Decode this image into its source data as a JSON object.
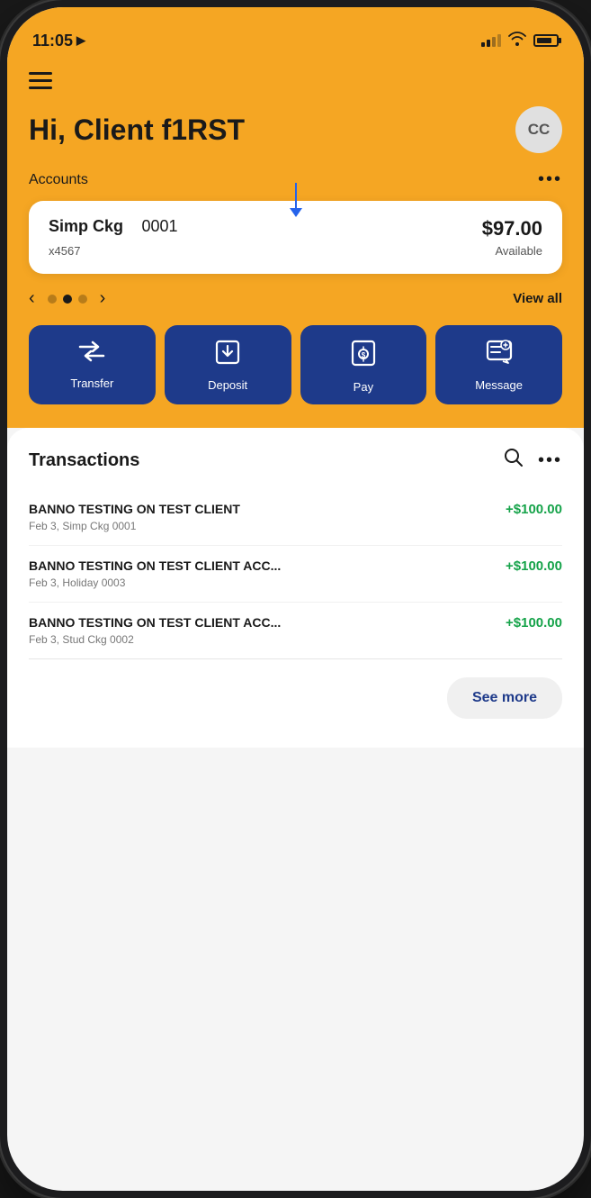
{
  "status_bar": {
    "time": "11:05",
    "location_icon": "▶",
    "battery_label": "battery"
  },
  "header": {
    "menu_label": "≡",
    "greeting": "Hi, Client f1RST",
    "avatar_initials": "CC",
    "accounts_label": "Accounts",
    "more_label": "•••",
    "view_all_label": "View all"
  },
  "account_card": {
    "name": "Simp Ckg",
    "number": "0001",
    "account_sub": "x4567",
    "amount": "$97.00",
    "available_label": "Available"
  },
  "carousel": {
    "prev": "‹",
    "next": "›"
  },
  "action_buttons": [
    {
      "id": "transfer",
      "label": "Transfer"
    },
    {
      "id": "deposit",
      "label": "Deposit"
    },
    {
      "id": "pay",
      "label": "Pay"
    },
    {
      "id": "message",
      "label": "Message"
    }
  ],
  "transactions": {
    "title": "Transactions",
    "items": [
      {
        "name": "BANNO TESTING ON TEST CLIENT",
        "sub": "Feb 3, Simp Ckg     0001",
        "amount": "+$100.00"
      },
      {
        "name": "BANNO TESTING ON TEST CLIENT ACC...",
        "sub": "Feb 3, Holiday     0003",
        "amount": "+$100.00"
      },
      {
        "name": "BANNO TESTING ON TEST CLIENT ACC...",
        "sub": "Feb 3, Stud Ckg     0002",
        "amount": "+$100.00"
      }
    ],
    "see_more_label": "See more"
  }
}
